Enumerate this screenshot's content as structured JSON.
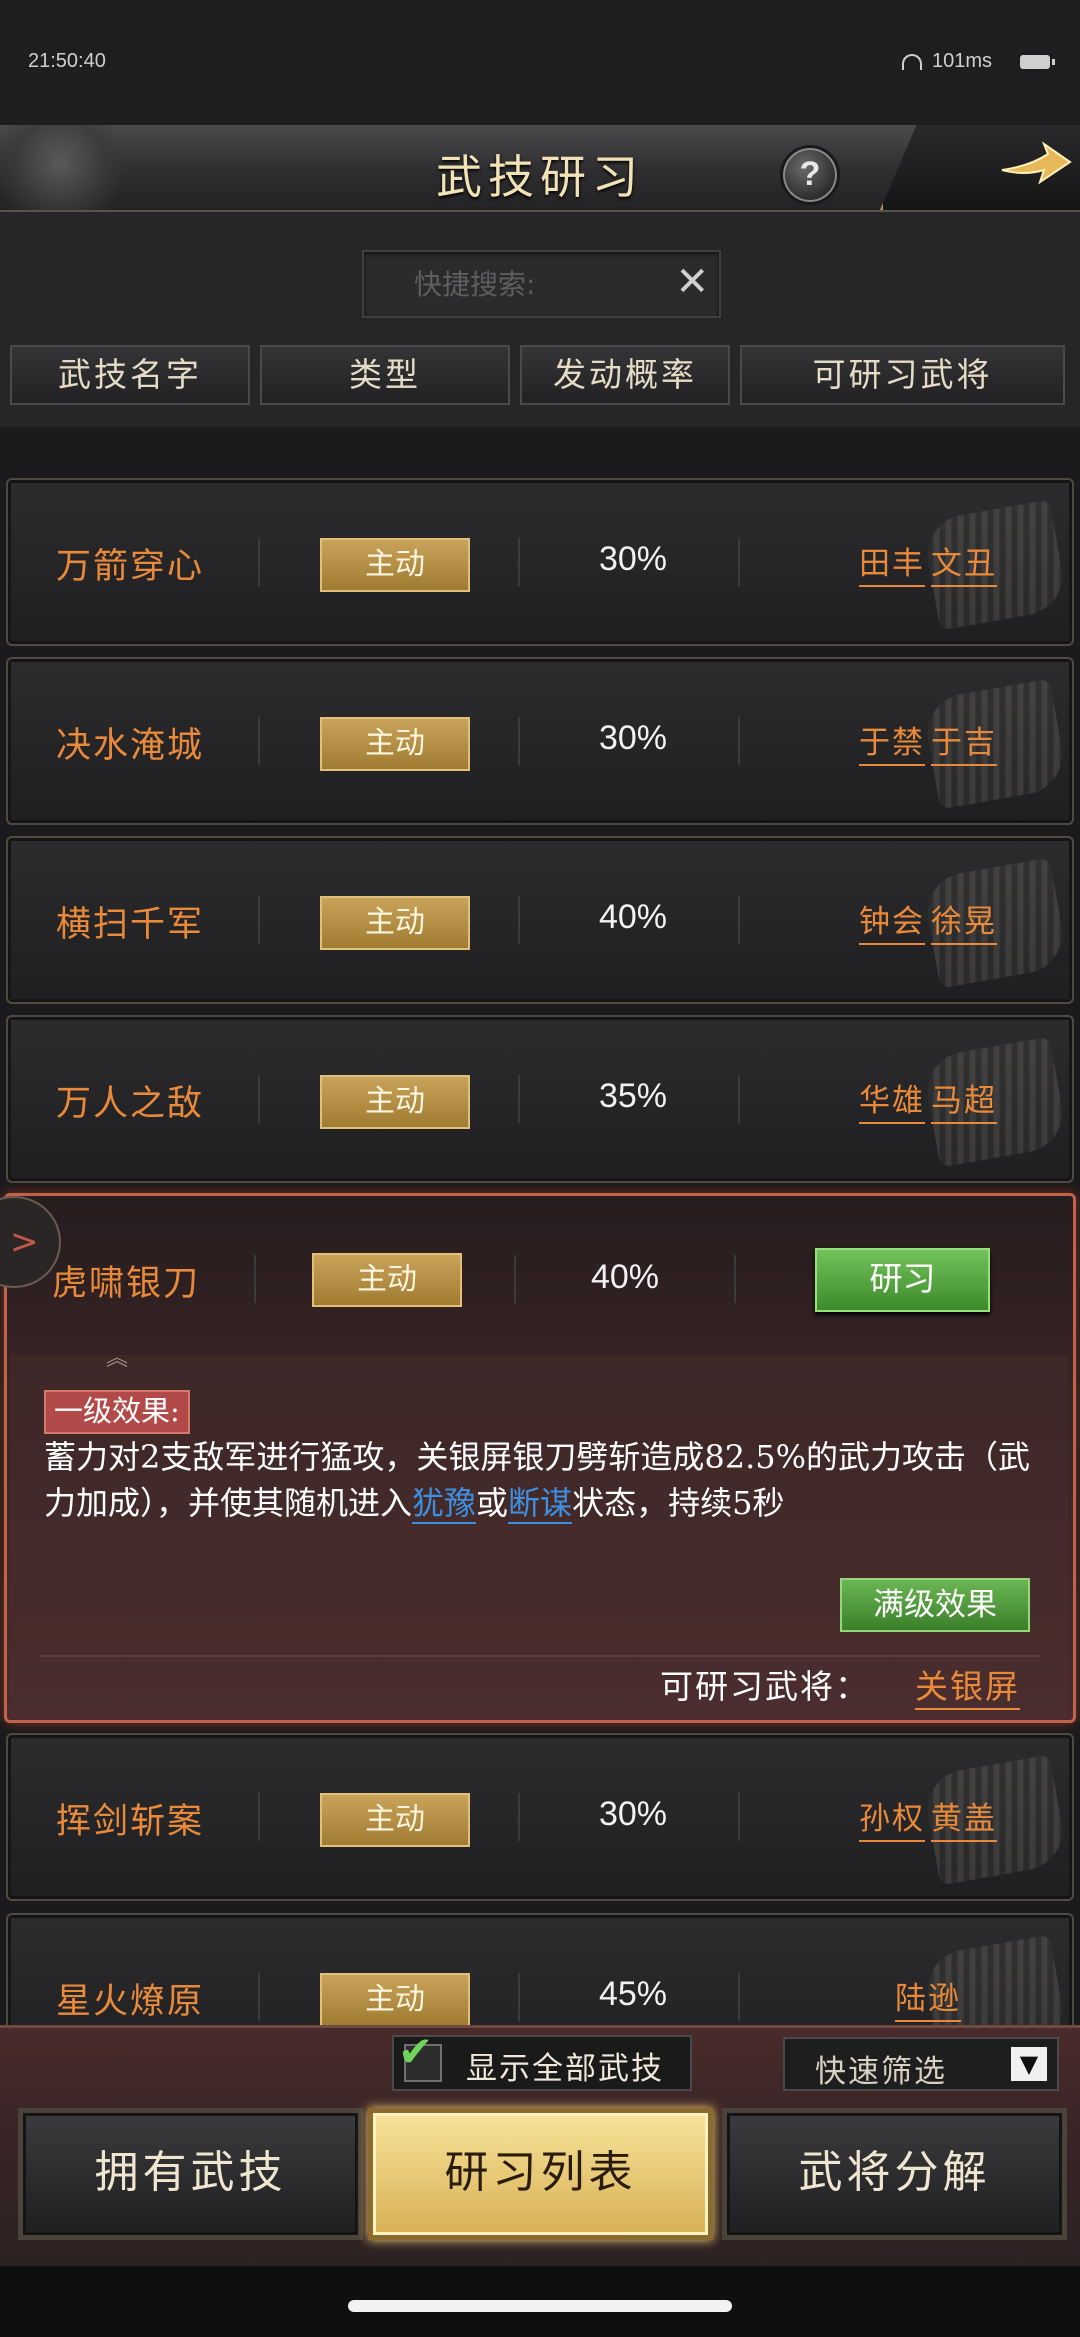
{
  "status_bar": {
    "time": "21:50:40",
    "ping": "101ms"
  },
  "header": {
    "title": "武技研习",
    "help_label": "?"
  },
  "search": {
    "placeholder": "快捷搜索:",
    "clear_label": "✕"
  },
  "columns": [
    "武技名字",
    "类型",
    "发动概率",
    "可研习武将"
  ],
  "rows": [
    {
      "name": "万箭穿心",
      "type": "主动",
      "rate": "30%",
      "generals": [
        "田丰",
        "文丑"
      ]
    },
    {
      "name": "决水淹城",
      "type": "主动",
      "rate": "30%",
      "generals": [
        "于禁",
        "于吉"
      ]
    },
    {
      "name": "横扫千军",
      "type": "主动",
      "rate": "40%",
      "generals": [
        "钟会",
        "徐晃"
      ]
    },
    {
      "name": "万人之敌",
      "type": "主动",
      "rate": "35%",
      "generals": [
        "华雄",
        "马超"
      ]
    },
    {
      "name": "挥剑斩案",
      "type": "主动",
      "rate": "30%",
      "generals": [
        "孙权",
        "黄盖"
      ]
    },
    {
      "name": "星火燎原",
      "type": "主动",
      "rate": "45%",
      "generals": [
        "陆逊"
      ]
    }
  ],
  "expanded": {
    "name": "虎啸银刀",
    "type": "主动",
    "rate": "40%",
    "study_label": "研习",
    "level_label": "一级效果:",
    "desc_part1": "蓄力对2支敌军进行猛攻，关银屏银刀劈斩造成82.5%的武力攻击（武力加成），并使其随机进入",
    "status1": "犹豫",
    "desc_or": "或",
    "status2": "断谋",
    "desc_part2": "状态，持续5秒",
    "max_label": "满级效果",
    "can_study_label": "可研习武将：",
    "general": "关银屏"
  },
  "footer": {
    "show_all_label": "显示全部武技",
    "quick_filter_label": "快速筛选",
    "tabs": [
      "拥有武技",
      "研习列表",
      "武将分解"
    ]
  }
}
